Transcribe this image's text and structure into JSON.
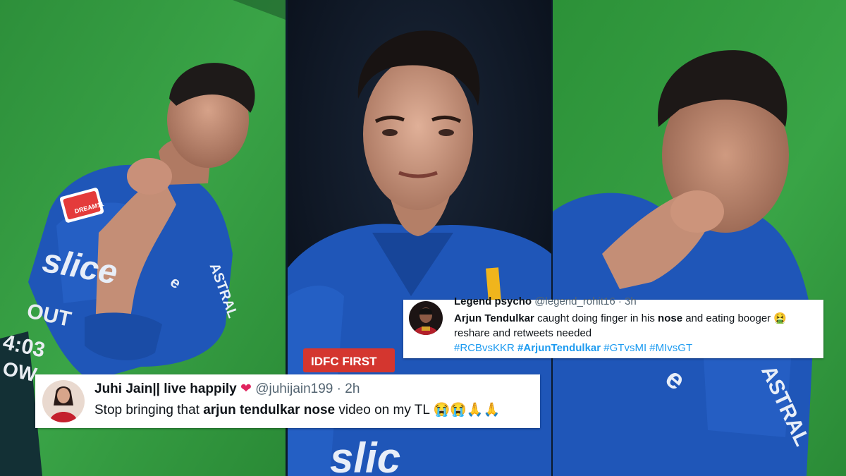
{
  "tweets": {
    "juhi": {
      "name": "Juhi Jain|| live happily",
      "name_emoji": "❤",
      "handle": "@juhijain199",
      "separator": "·",
      "time": "2h",
      "text_before": "Stop bringing that ",
      "text_bold": "arjun tendulkar nose",
      "text_after": " video on my TL ",
      "emojis": "😭😭🙏🙏"
    },
    "legend": {
      "name": "Legend psycho",
      "handle": "@legend_rohit16",
      "separator": "·",
      "time": "3h",
      "line1_bold": "Arjun Tendulkar",
      "line1_mid": " caught doing finger in his ",
      "line1_bold2": "nose",
      "line1_end": " and eating booger ",
      "line1_emoji": "🤮",
      "line2": "reshare and retweets needed",
      "hashtags": [
        "#RCBvsKKR",
        "#ArjunTendulkar",
        "#GTvsMI",
        "#MIvsGT"
      ]
    }
  },
  "jersey_texts": {
    "left_sponsor": "slice",
    "left_brand": "ASTRAL",
    "left_patch": "DREAM11",
    "right_brand": "ASTRAL",
    "mid_sponsor": "IDFC FIRST",
    "mid_brand": "slic"
  },
  "scoreboard": {
    "line1": "OUT",
    "line2": "4:03",
    "line3": "OW"
  },
  "colors": {
    "jersey_blue": "#1f56b8",
    "pitch_green": "#2f9a3c",
    "dark_bg": "#0c1b2e",
    "hashtag": "#1d9bf0"
  }
}
